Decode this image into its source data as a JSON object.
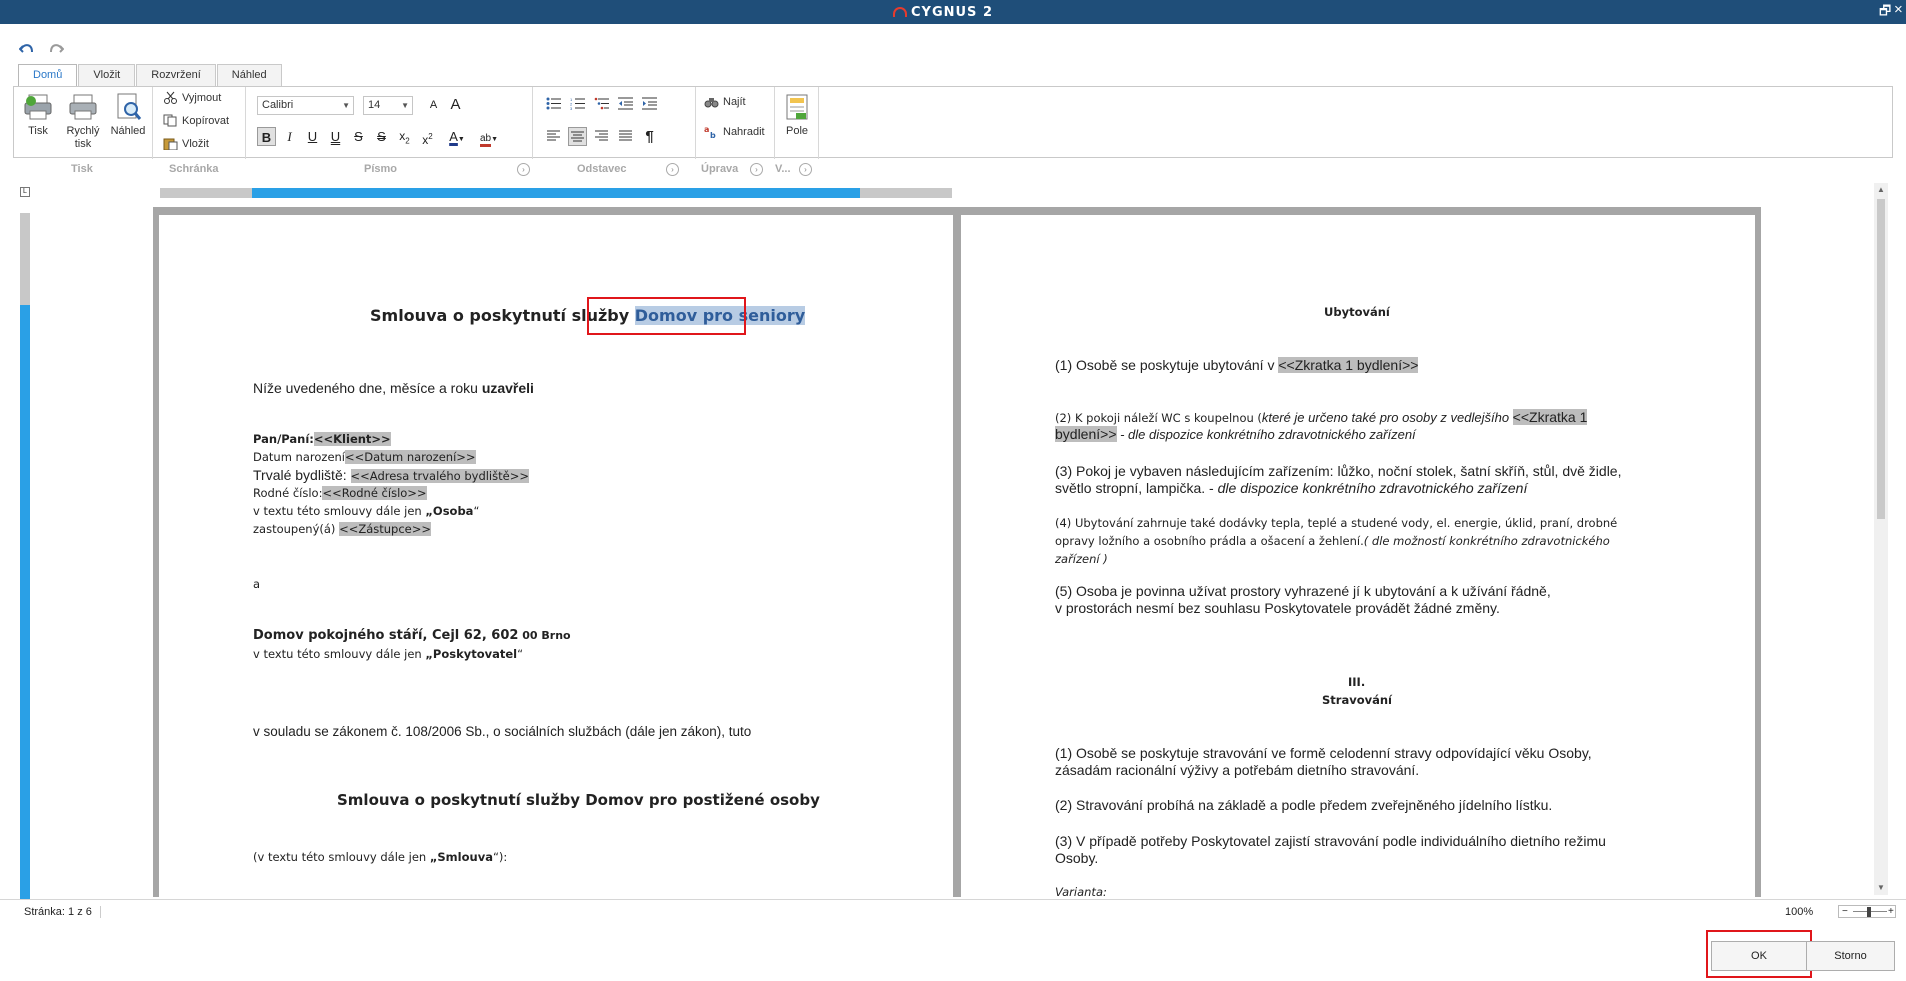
{
  "app": {
    "brand": "CYGNUS 2"
  },
  "window": {
    "restore_glyph": "🗗",
    "close_glyph": "×"
  },
  "quick_access": {
    "undo_icon": "undo-icon",
    "redo_icon": "redo-icon"
  },
  "ribbon": {
    "tabs": [
      "Domů",
      "Vložit",
      "Rozvržení",
      "Náhled"
    ],
    "active_tab": "Domů",
    "print": {
      "print": "Tisk",
      "quick_print_1": "Rychlý",
      "quick_print_2": "tisk",
      "preview": "Náhled"
    },
    "clipboard": {
      "cut": "Vyjmout",
      "copy": "Kopírovat",
      "paste": "Vložit"
    },
    "font": {
      "family": "Calibri",
      "size": "14"
    },
    "editing": {
      "find": "Najít",
      "replace": "Nahradit"
    },
    "fields": {
      "field": "Pole"
    },
    "group_labels": [
      "Tisk",
      "Schránka",
      "Písmo",
      "Odstavec",
      "Úprava",
      "V..."
    ]
  },
  "document": {
    "page1": {
      "title_prefix": "Smlouva o poskytnutí služby",
      "title_selected": "Domov pro seniory",
      "intro_plain": "Níže uvedeného dne, měsíce a roku ",
      "intro_bold": "uzavřeli",
      "client_label": "Pan/Paní:",
      "client_value": "<<Klient>>",
      "dob_label": "Datum narození",
      "dob_value": "<<Datum narození>>",
      "residence_label": "Trvalé bydliště: ",
      "residence_value": "<<Adresa trvalého bydliště>>",
      "idnum_label": "Rodné číslo:",
      "idnum_value": "<<Rodné číslo>>",
      "osoba_prefix": "v textu této smlouvy dále jen ",
      "osoba_bold": "„Osoba",
      "osoba_suffix": "“",
      "rep_label": "zastoupený(á) ",
      "rep_value": "<<Zástupce>>",
      "and": "a",
      "provider_name": "Domov pokojného stáří, Cejl 62, 602",
      "provider_zip": " 00 Brno",
      "provider_prefix": "v textu této smlouvy dále jen ",
      "provider_bold": "„Poskytovatel",
      "provider_suffix": "“",
      "law": "v souladu se zákonem č. 108/2006 Sb., o sociálních službách (dále jen zákon), tuto",
      "title2": "Smlouva o poskytnutí služby Domov pro postižené osoby",
      "smlouva_prefix": "(v textu této smlouvy dále jen ",
      "smlouva_bold": "„Smlouva",
      "smlouva_suffix": "“):"
    },
    "page2": {
      "heading_accommodation": "Ubytování",
      "a1_text": "(1) Osobě se poskytuje ubytování v ",
      "a1_ph": "<<Zkratka 1 bydlení>>",
      "a2_text": "(2) K pokoji náleží WC s koupelnou (",
      "a2_italic": "které je určeno také pro osoby z vedlejšího ",
      "a2_ph1": "<<Zkratka 1",
      "a2_ph2": "bydlení>>",
      "a2_italic2": " - dle dispozice konkrétního zdravotnického zařízení",
      "a3_line1": "(3) Pokoj je vybaven následujícím zařízením: lůžko, noční stolek, šatní skříň, stůl, dvě židle,",
      "a3_line2": "světlo stropní, lampička. - ",
      "a3_italic": "dle dispozice konkrétního zdravotnického zařízení",
      "a4_line1": "(4) Ubytování zahrnuje také dodávky tepla, teplé a studené vody, el. energie, úklid, praní, drobné",
      "a4_line2": "opravy ložního a osobního prádla a ošacení a žehlení.",
      "a4_italic2": "( dle možností konkrétního zdravotnického",
      "a4_italic3": "zařízení )",
      "a5_line1": "(5) Osoba je povinna užívat prostory vyhrazené jí k ubytování a k užívání řádně,",
      "a5_line2": "v prostorách nesmí bez souhlasu Poskytovatele provádět žádné změny.",
      "sec3_num": "III.",
      "sec3_title": "Stravování",
      "s1_line1": "(1) Osobě se poskytuje stravování ve formě celodenní stravy odpovídající věku Osoby,",
      "s1_line2": "zásadám racionální výživy a potřebám dietního stravování.",
      "s2": "(2) Stravování probíhá na základě a podle předem zveřejněného jídelního lístku.",
      "s3_line1": "(3) V případě potřeby Poskytovatel zajistí stravování podle individuálního dietního režimu",
      "s3_line2": "Osoby.",
      "variant": "Varianta:"
    }
  },
  "status": {
    "page": "Stránka: 1 z 6",
    "zoom": "100%"
  },
  "buttons": {
    "ok": "OK",
    "cancel": "Storno"
  },
  "colors": {
    "titlebar": "#1f4e79",
    "ruler": "#2aa0e6",
    "highlight": "#e0161b",
    "placeholder": "#bdbdbd"
  }
}
